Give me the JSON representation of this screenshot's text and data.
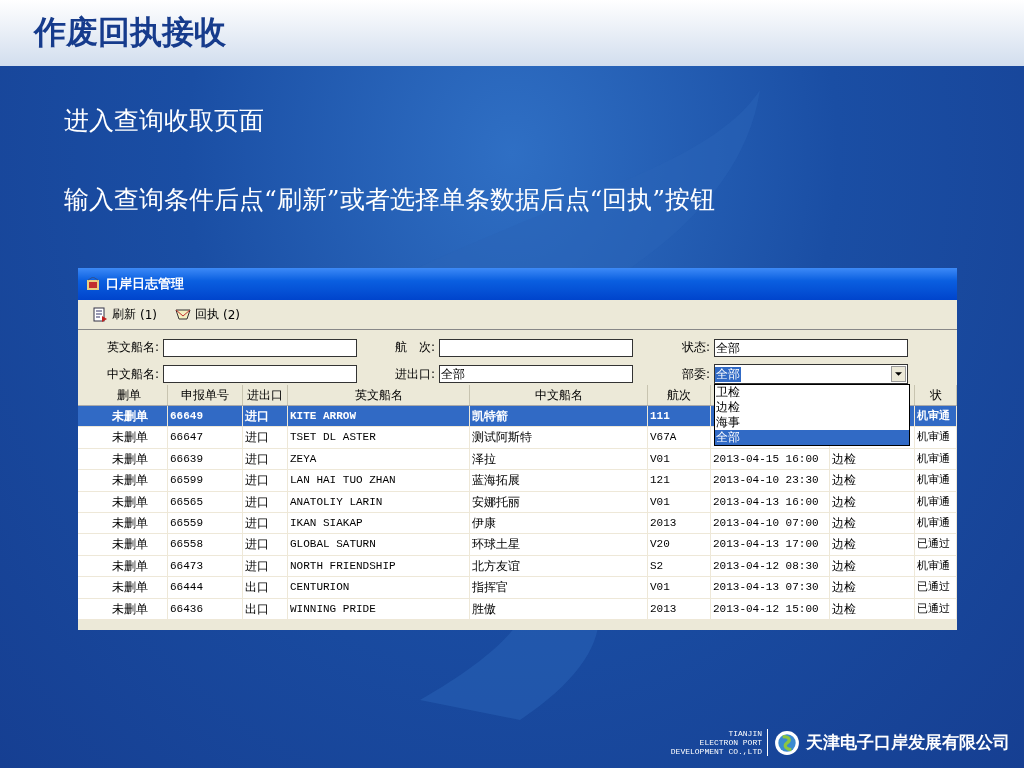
{
  "slide": {
    "title": "作废回执接收",
    "bullets": [
      "进入查询收取页面",
      "输入查询条件后点“刷新”或者选择单条数据后点“回执”按钮"
    ]
  },
  "window": {
    "title": "口岸日志管理",
    "toolbar": [
      {
        "label": "刷新",
        "key": "(1)",
        "kind": "refresh"
      },
      {
        "label": "回执",
        "key": "(2)",
        "kind": "receipt"
      }
    ],
    "form": [
      {
        "label": "英文船名:",
        "kind": "text"
      },
      {
        "label": "航　次:",
        "kind": "text"
      },
      {
        "label": "状态:",
        "value": "全部",
        "kind": "text"
      },
      {
        "label": "中文船名:",
        "kind": "text"
      },
      {
        "label": "进出口:",
        "value": "全部",
        "kind": "text"
      },
      {
        "label": "部委:",
        "value": "全部",
        "kind": "combo",
        "focused": true,
        "expanded": true,
        "options": [
          {
            "label": "卫检",
            "selected": false
          },
          {
            "label": "边检",
            "selected": false
          },
          {
            "label": "海事",
            "selected": false
          },
          {
            "label": "全部",
            "selected": true
          }
        ]
      }
    ],
    "table": {
      "columns": [
        "删单",
        "申报单号",
        "进出口",
        "英文船名",
        "中文船名",
        "航次",
        null,
        null,
        "状"
      ],
      "rows": [
        {
          "selected": true,
          "cells": [
            "未删单",
            "66649",
            "进口",
            "KITE ARROW",
            "凯特箭",
            "111",
            null,
            null,
            "机审通"
          ]
        },
        {
          "selected": false,
          "cells": [
            "未删单",
            "66647",
            "进口",
            "TSET DL ASTER",
            "测试阿斯特",
            "V67A",
            null,
            null,
            "机审通"
          ]
        },
        {
          "selected": false,
          "cells": [
            "未删单",
            "66639",
            "进口",
            "ZEYA",
            "泽拉",
            "V01",
            "2013-04-15 16:00",
            "边检",
            "机审通"
          ]
        },
        {
          "selected": false,
          "cells": [
            "未删单",
            "66599",
            "进口",
            "LAN HAI TUO ZHAN",
            "蓝海拓展",
            "121",
            "2013-04-10 23:30",
            "边检",
            "机审通"
          ]
        },
        {
          "selected": false,
          "cells": [
            "未删单",
            "66565",
            "进口",
            "ANATOLIY LARIN",
            "安娜托丽",
            "V01",
            "2013-04-13 16:00",
            "边检",
            "机审通"
          ]
        },
        {
          "selected": false,
          "cells": [
            "未删单",
            "66559",
            "进口",
            "IKAN SIAKAP",
            "伊康",
            "2013",
            "2013-04-10 07:00",
            "边检",
            "机审通"
          ]
        },
        {
          "selected": false,
          "cells": [
            "未删单",
            "66558",
            "进口",
            "GLOBAL SATURN",
            "环球土星",
            "V20",
            "2013-04-13 17:00",
            "边检",
            "已通过"
          ]
        },
        {
          "selected": false,
          "cells": [
            "未删单",
            "66473",
            "进口",
            "NORTH FRIENDSHIP",
            "北方友谊",
            "S2",
            "2013-04-12 08:30",
            "边检",
            "机审通"
          ]
        },
        {
          "selected": false,
          "cells": [
            "未删单",
            "66444",
            "出口",
            "CENTURION",
            "指挥官",
            "V01",
            "2013-04-13 07:30",
            "边检",
            "已通过"
          ]
        },
        {
          "selected": false,
          "cells": [
            "未删单",
            "66436",
            "出口",
            "WINNING PRIDE",
            "胜傲",
            "2013",
            "2013-04-12 15:00",
            "边检",
            "已通过"
          ]
        }
      ]
    }
  },
  "footer": {
    "english": [
      "TIANJIN",
      "ELECTRON PORT",
      "DEVELOPMENT CO.,LTD"
    ],
    "company": "天津电子口岸发展有限公司"
  }
}
